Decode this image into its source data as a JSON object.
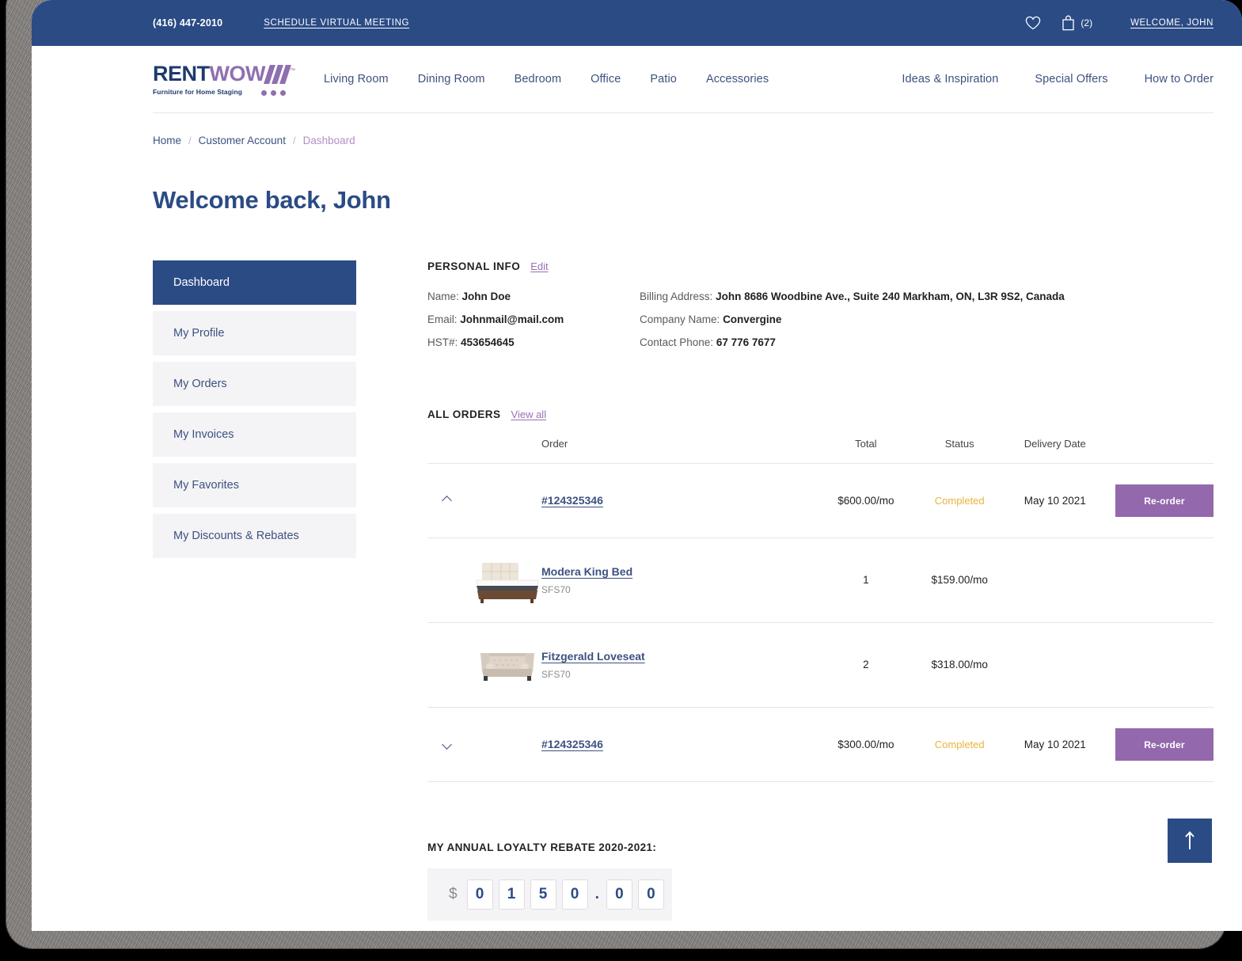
{
  "topbar": {
    "phone": "(416) 447-2010",
    "schedule_link": "SCHEDULE VIRTUAL MEETING",
    "favorites_icon": "heart-icon",
    "cart_icon": "cart-bag-icon",
    "cart_count": "(2)",
    "welcome_link": "WELCOME, JOHN"
  },
  "brand": {
    "name_part1": "RENT",
    "name_part2": "WOW",
    "trademark": "™",
    "tagline": "Furniture for Home Staging"
  },
  "nav": {
    "primary": [
      {
        "label": "Living Room"
      },
      {
        "label": "Dining Room"
      },
      {
        "label": "Bedroom"
      },
      {
        "label": "Office"
      },
      {
        "label": "Patio"
      },
      {
        "label": "Accessories"
      }
    ],
    "secondary": [
      {
        "label": "Ideas & Inspiration"
      },
      {
        "label": "Special Offers"
      },
      {
        "label": "How to Order"
      }
    ]
  },
  "breadcrumb": {
    "home": "Home",
    "sep1": "/",
    "account": "Customer Account",
    "sep2": "/",
    "current": "Dashboard"
  },
  "page_title": "Welcome back, John",
  "sidebar": {
    "items": [
      {
        "label": "Dashboard"
      },
      {
        "label": "My Profile"
      },
      {
        "label": "My Orders"
      },
      {
        "label": "My Invoices"
      },
      {
        "label": "My Favorites"
      },
      {
        "label": "My Discounts & Rebates"
      }
    ]
  },
  "personal_info": {
    "title": "PERSONAL INFO",
    "edit_label": "Edit",
    "name_label": "Name:",
    "name_value": "John Doe",
    "email_label": "Email:",
    "email_value": "Johnmail@mail.com",
    "hst_label": "HST#:",
    "hst_value": "453654645",
    "billing_label": "Billing Address:",
    "billing_value": "John 8686 Woodbine Ave., Suite 240 Markham, ON, L3R 9S2, Canada",
    "company_label": "Company Name:",
    "company_value": "Convergine",
    "phone_label": "Contact Phone:",
    "phone_value": "67 776 7677"
  },
  "orders": {
    "title": "ALL ORDERS",
    "view_all_label": "View all",
    "columns": {
      "order": "Order",
      "total": "Total",
      "status": "Status",
      "delivery": "Delivery Date"
    },
    "rows": [
      {
        "id": "#124325346",
        "total": "$600.00/mo",
        "status": "Completed",
        "delivery": "May 10 2021",
        "action": "Re-order",
        "expanded": true,
        "toggle_icon": "chevron-up-icon",
        "products": [
          {
            "thumb": "king-bed-thumb",
            "name": "Modera King Bed",
            "sku": "SFS70",
            "qty": "1",
            "price": "$159.00/mo"
          },
          {
            "thumb": "loveseat-thumb",
            "name": "Fitzgerald Loveseat",
            "sku": "SFS70",
            "qty": "2",
            "price": "$318.00/mo"
          }
        ]
      },
      {
        "id": "#124325346",
        "total": "$300.00/mo",
        "status": "Completed",
        "delivery": "May 10 2021",
        "action": "Re-order",
        "expanded": false,
        "toggle_icon": "chevron-down-icon",
        "products": []
      }
    ]
  },
  "rebate": {
    "title": "MY ANNUAL LOYALTY REBATE 2020-2021:",
    "currency": "$",
    "digits_int": [
      "0",
      "1",
      "5",
      "0"
    ],
    "decimal_sep": ".",
    "digits_dec": [
      "0",
      "0"
    ]
  },
  "scroll_top": {
    "icon": "arrow-up-icon"
  },
  "colors": {
    "navy": "#2b4b85",
    "purple": "#9468ac",
    "logo_purple": "#8f6fb0",
    "link_blue": "#3d5180",
    "status_amber": "#e8b33c",
    "panel_grey": "#f4f4f6"
  }
}
